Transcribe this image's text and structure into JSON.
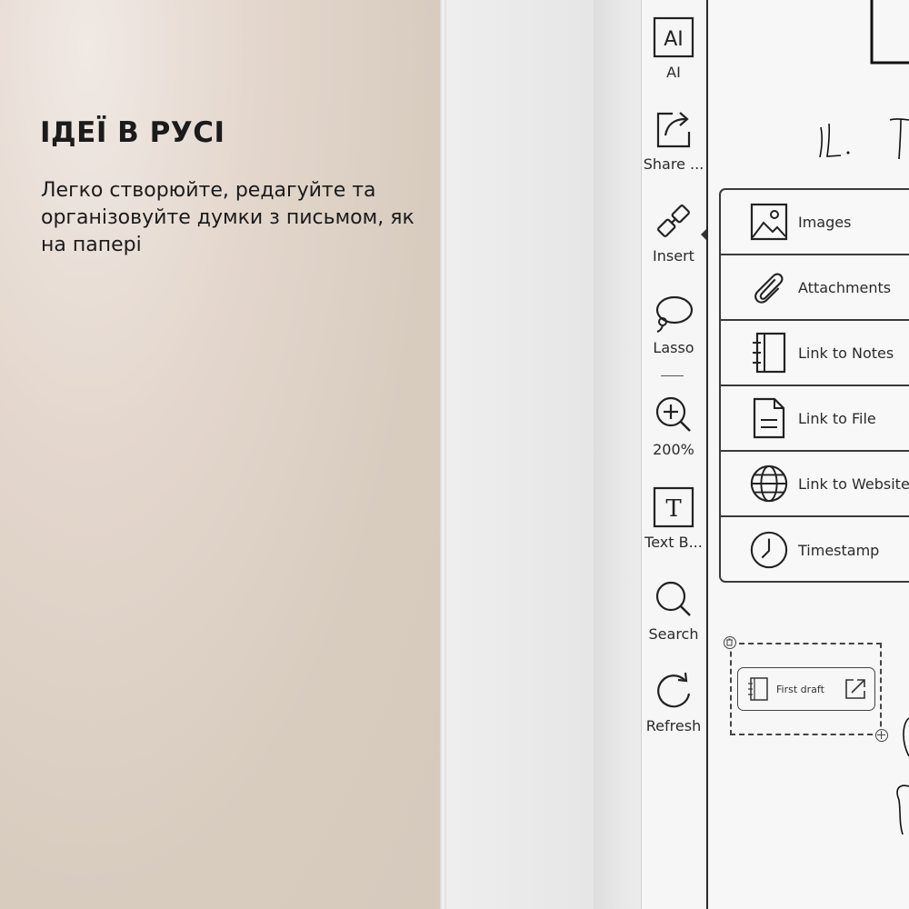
{
  "promo": {
    "title": "ІДЕЇ В РУСІ",
    "description": "Легко створюйте, редагуйте та організовуйте думки з письмом, як на папері"
  },
  "toolbar": {
    "items": [
      {
        "label": "AI",
        "icon": "ai-icon"
      },
      {
        "label": "Share ...",
        "icon": "share-icon"
      },
      {
        "label": "Insert",
        "icon": "insert-icon"
      },
      {
        "label": "Lasso",
        "icon": "lasso-icon"
      },
      {
        "label": "200%",
        "icon": "zoom-in-icon"
      },
      {
        "label": "Text B...",
        "icon": "text-box-icon"
      },
      {
        "label": "Search",
        "icon": "search-icon"
      },
      {
        "label": "Refresh",
        "icon": "refresh-icon"
      }
    ]
  },
  "insert_menu": {
    "items": [
      {
        "label": "Images",
        "icon": "image-icon"
      },
      {
        "label": "Attachments",
        "icon": "paperclip-icon"
      },
      {
        "label": "Link to Notes",
        "icon": "notebook-icon"
      },
      {
        "label": "Link to File",
        "icon": "file-icon"
      },
      {
        "label": "Link to Website",
        "icon": "globe-icon"
      },
      {
        "label": "Timestamp",
        "icon": "clock-icon"
      }
    ]
  },
  "canvas": {
    "handwriting": "ІL. T",
    "link_card": {
      "label": "First draft"
    }
  },
  "colors": {
    "promo_bg": "#d8ccbf",
    "ink": "#222222",
    "screen_bg": "#f6f6f6"
  }
}
